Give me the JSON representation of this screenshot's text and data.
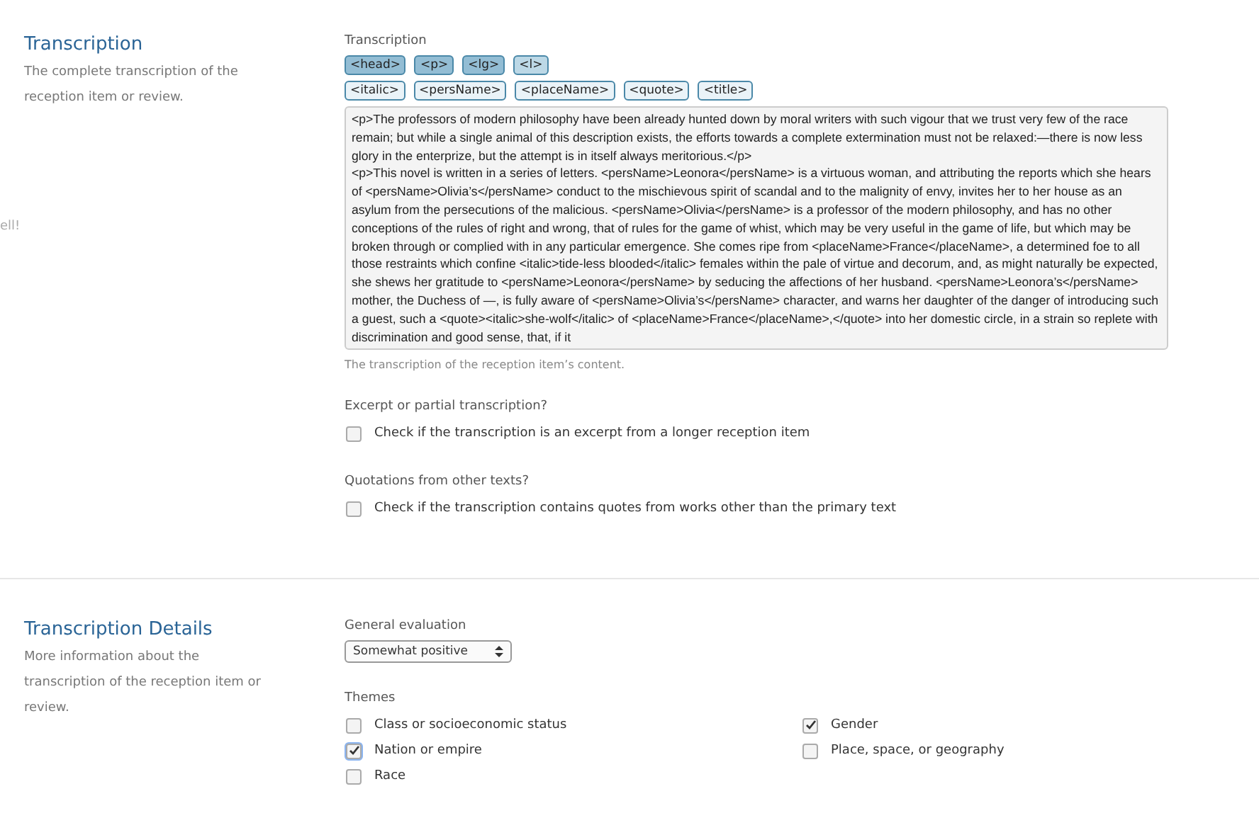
{
  "faint_text": "ell!",
  "sections": [
    {
      "title": "Transcription",
      "description": "The complete transcription of the reception item or review.",
      "fields": [
        {
          "kind": "editor",
          "label": "Transcription",
          "tag_rows": [
            [
              {
                "label": "<head>",
                "kind": "block"
              },
              {
                "label": "<p>",
                "kind": "block"
              },
              {
                "label": "<lg>",
                "kind": "block"
              },
              {
                "label": "<l>",
                "kind": "line"
              }
            ],
            [
              {
                "label": "<italic>",
                "kind": "inline"
              },
              {
                "label": "<persName>",
                "kind": "inline"
              },
              {
                "label": "<placeName>",
                "kind": "inline"
              },
              {
                "label": "<quote>",
                "kind": "inline"
              },
              {
                "label": "<title>",
                "kind": "inline"
              }
            ]
          ],
          "value": "<p>The professors of modern philosophy have been already hunted down by moral writers with such vigour that we trust very few of the race remain; but while a single animal of this description exists, the efforts towards a complete extermination must not be relaxed:—there is now less glory in the enterprize, but the attempt is in itself always meritorious.</p>\n<p>This novel is written in a series of letters. <persName>Leonora</persName> is a virtuous woman, and attributing the reports which she hears of <persName>Olivia’s</persName> conduct to the mischievous spirit of scandal and to the malignity of envy, invites her to her house as an asylum from the persecutions of the malicious. <persName>Olivia</persName> is a professor of the modern philosophy, and has no other conceptions of the rules of right and wrong, that of rules for the game of whist, which may be very useful in the game of life, but which may be broken through or complied with in any particular emergence. She comes ripe from <placeName>France</placeName>, a determined foe to all those restraints which confine <italic>tide-less blooded</italic> females within the pale of virtue and decorum, and, as might naturally be expected, she shews her gratitude to <persName>Leonora</persName> by seducing the affections of her husband. <persName>Leonora’s</persName> mother, the Duchess of —, is fully aware of <persName>Olivia’s</persName> character, and warns her daughter of the danger of introducing such a guest, such a <quote><italic>she-wolf</italic> of <placeName>France</placeName>,</quote> into her domestic circle, in a strain so replete with discrimination and good sense, that, if it",
          "help": "The transcription of the reception item’s content."
        },
        {
          "kind": "checkbox",
          "label": "Excerpt or partial transcription?",
          "options": [
            {
              "label": "Check if the transcription is an excerpt from a longer reception item",
              "checked": false,
              "focused": false
            }
          ]
        },
        {
          "kind": "checkbox",
          "label": "Quotations from other texts?",
          "options": [
            {
              "label": "Check if the transcription contains quotes from works other than the primary text",
              "checked": false,
              "focused": false
            }
          ]
        }
      ]
    },
    {
      "title": "Transcription Details",
      "description": "More information about the transcription of the reception item or review.",
      "fields": [
        {
          "kind": "select",
          "label": "General evaluation",
          "value": "Somewhat positive"
        },
        {
          "kind": "themes",
          "label": "Themes",
          "options": [
            {
              "label": "Class or socioeconomic status",
              "checked": false,
              "focused": false
            },
            {
              "label": "Gender",
              "checked": true,
              "focused": false
            },
            {
              "label": "Nation or empire",
              "checked": true,
              "focused": true
            },
            {
              "label": "Place, space, or geography",
              "checked": false,
              "focused": false
            },
            {
              "label": "Race",
              "checked": false,
              "focused": false
            }
          ]
        }
      ]
    }
  ]
}
